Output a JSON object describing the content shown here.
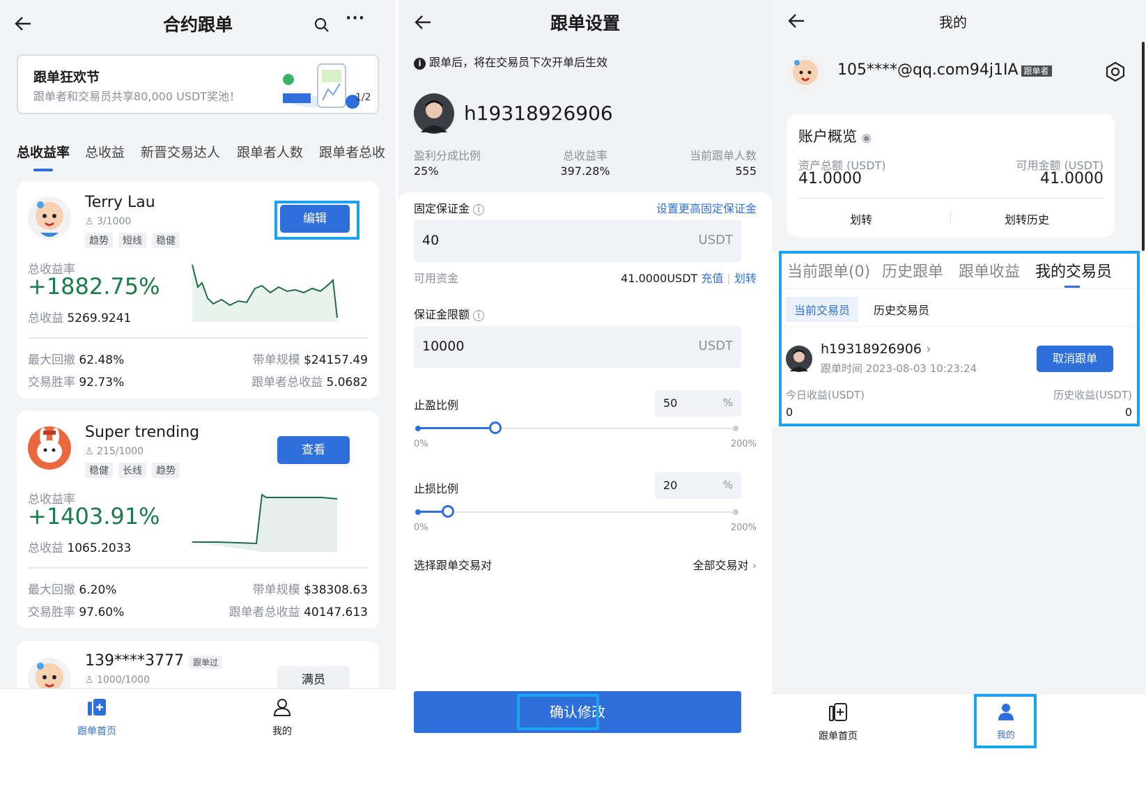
{
  "screen1": {
    "title": "合约跟单",
    "banner": {
      "title": "跟单狂欢节",
      "subtitle": "跟单者和交易员共享80,000 USDT奖池！",
      "pager": "1/2"
    },
    "tabs": [
      "总收益率",
      "总收益",
      "新晋交易达人",
      "跟单者人数",
      "跟单者总收"
    ],
    "traders": [
      {
        "name": "Terry Lau",
        "followers": "3/1000",
        "tags": [
          "趋势",
          "短线",
          "稳健"
        ],
        "button": "编辑",
        "roi_label": "总收益率",
        "roi": "+1882.75%",
        "pnl_label": "总收益",
        "pnl": "5269.9241",
        "mdd_label": "最大回撤",
        "mdd": "62.48%",
        "scale_label": "带单规模",
        "scale": "$24157.49",
        "win_label": "交易胜率",
        "win": "92.73%",
        "fpnl_label": "跟单者总收益",
        "fpnl": "5.0682"
      },
      {
        "name": "Super trending",
        "followers": "215/1000",
        "tags": [
          "稳健",
          "长线",
          "趋势"
        ],
        "button": "查看",
        "roi_label": "总收益率",
        "roi": "+1403.91%",
        "pnl_label": "总收益",
        "pnl": "1065.2033",
        "mdd_label": "最大回撤",
        "mdd": "6.20%",
        "scale_label": "带单规模",
        "scale": "$38308.63",
        "win_label": "交易胜率",
        "win": "97.60%",
        "fpnl_label": "跟单者总收益",
        "fpnl": "40147.613"
      },
      {
        "name": "139****3777",
        "badge": "跟单过",
        "followers": "1000/1000",
        "button": "满员"
      }
    ],
    "nav": {
      "home": "跟单首页",
      "mine": "我的"
    }
  },
  "screen2": {
    "title": "跟单设置",
    "notice": "跟单后，将在交易员下次开单后生效",
    "trader": "h19318926906",
    "stats": [
      {
        "label": "盈利分成比例",
        "value": "25%"
      },
      {
        "label": "总收益率",
        "value": "397.28%"
      },
      {
        "label": "当前跟单人数",
        "value": "555"
      }
    ],
    "fixed_margin": {
      "label": "固定保证金",
      "link": "设置更高固定保证金",
      "value": "40",
      "unit": "USDT"
    },
    "available": {
      "label": "可用资金",
      "value": "41.0000USDT",
      "deposit": "充值",
      "transfer": "划转"
    },
    "margin_limit": {
      "label": "保证金限额",
      "value": "10000",
      "unit": "USDT"
    },
    "take_profit": {
      "label": "止盈比例",
      "value": "50",
      "unit": "%",
      "min": "0%",
      "max": "200%",
      "level": 0.25
    },
    "stop_loss": {
      "label": "止损比例",
      "value": "20",
      "unit": "%",
      "min": "0%",
      "max": "200%",
      "level": 0.1
    },
    "pair": {
      "label": "选择跟单交易对",
      "value": "全部交易对"
    },
    "confirm": "确认修改"
  },
  "screen3": {
    "title": "我的",
    "email": "105****@qq.com94j1IA",
    "role_badge": "跟单者",
    "overview": {
      "title": "账户概览",
      "total_label": "资产总额 (USDT)",
      "total": "41.0000",
      "avail_label": "可用金额 (USDT)",
      "avail": "41.0000",
      "transfer": "划转",
      "history": "划转历史"
    },
    "tabs": [
      "当前跟单(0)",
      "历史跟单",
      "跟单收益",
      "我的交易员"
    ],
    "subtabs": [
      "当前交易员",
      "历史交易员"
    ],
    "trader": {
      "name": "h19318926906",
      "time_label": "跟单时间",
      "time": "2023-08-03 10:23:24",
      "cancel": "取消跟单",
      "today_label": "今日收益(USDT)",
      "today": "0",
      "hist_label": "历史收益(USDT)",
      "hist": "0"
    },
    "nav": {
      "home": "跟单首页",
      "mine": "我的"
    }
  },
  "colors": {
    "accent": "#2f6fdc",
    "highlight": "#1aa3ef",
    "profit": "#1b7a4a"
  }
}
